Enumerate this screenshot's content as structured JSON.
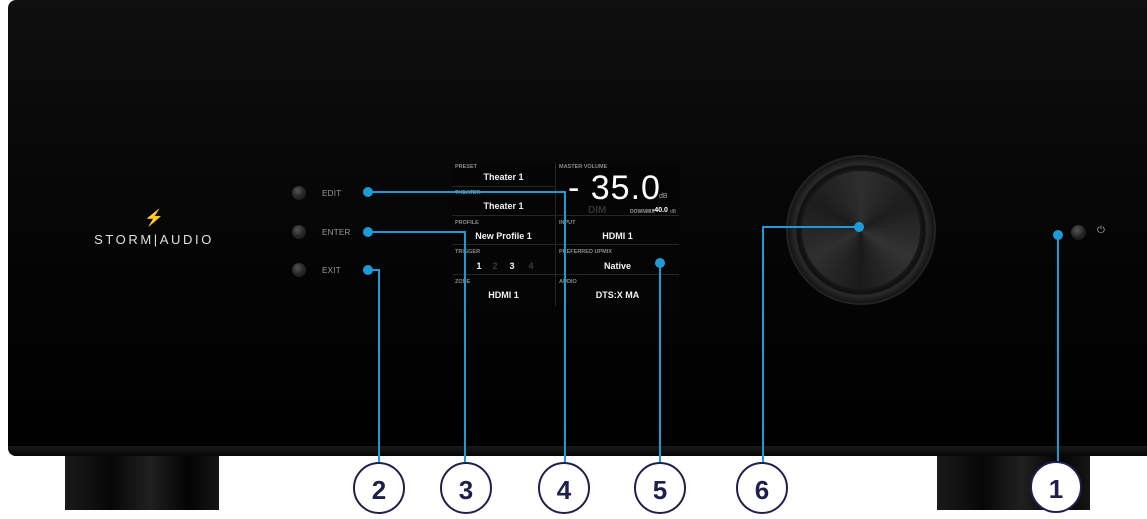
{
  "brand": {
    "icon": "bolt-icon",
    "name": "STORM|AUDIO"
  },
  "buttons": {
    "edit": "EDIT",
    "enter": "ENTER",
    "exit": "EXIT"
  },
  "display": {
    "preset": {
      "label": "PRESET",
      "value": "Theater 1"
    },
    "theater": {
      "label": "THEATER",
      "value": "Theater 1"
    },
    "profile": {
      "label": "PROFILE",
      "value": "New Profile 1"
    },
    "trigger": {
      "label": "TRIGGER",
      "values": [
        "1",
        "2",
        "3",
        "4"
      ]
    },
    "zone": {
      "label": "ZONE",
      "value": "HDMI 1"
    },
    "master_volume": {
      "label": "MASTER VOLUME",
      "value": "- 35.0",
      "unit": "dB"
    },
    "dim": "DIM",
    "downmix": {
      "label": "DOWNMIX",
      "value": "-40.0",
      "unit": "dB"
    },
    "input": {
      "label": "INPUT",
      "value": "HDMI 1"
    },
    "preferred_upmix": {
      "label": "PREFERRED UPMIX",
      "value": "Native"
    },
    "audio": {
      "label": "AUDIO",
      "value": "DTS:X MA"
    }
  },
  "power": {
    "icon": "power-icon",
    "glyph": "⏻"
  },
  "callouts": [
    "1",
    "2",
    "3",
    "4",
    "5",
    "6"
  ],
  "colors": {
    "accent": "#1e9bd7",
    "badge_border": "#1f1f4d",
    "chassis": "#080808"
  }
}
